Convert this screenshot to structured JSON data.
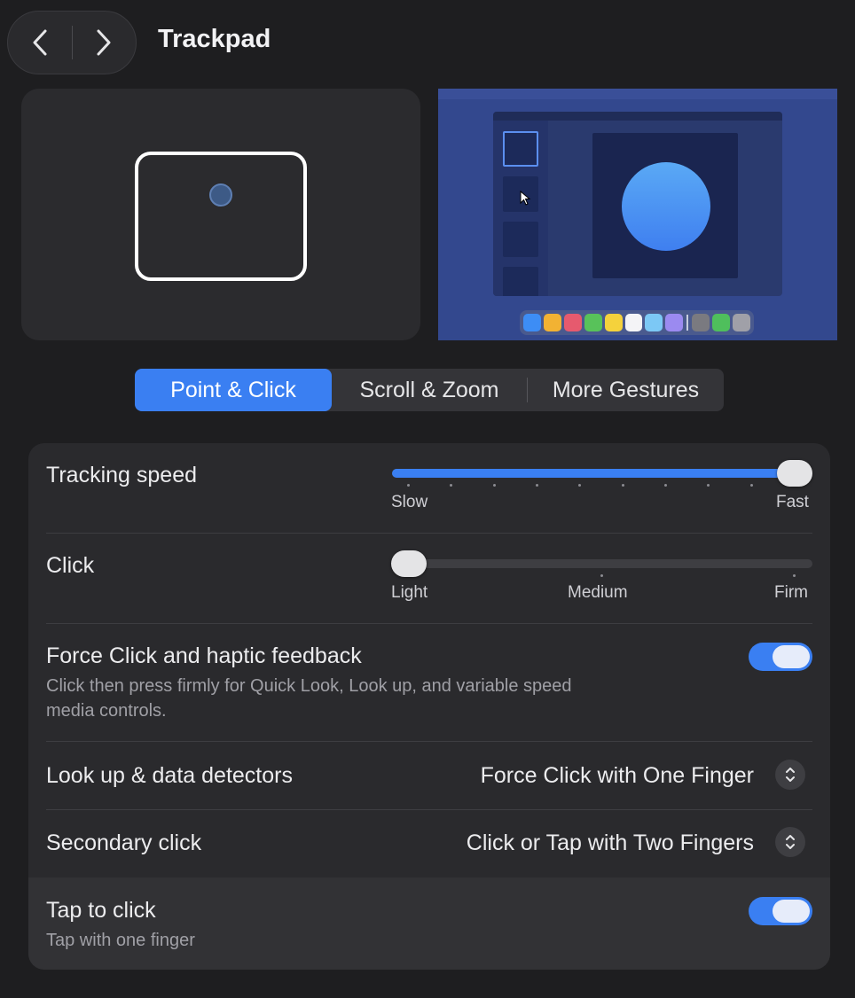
{
  "header": {
    "title": "Trackpad",
    "back_icon": "chevron-left-icon",
    "forward_icon": "chevron-right-icon"
  },
  "tabs": [
    {
      "label": "Point & Click",
      "active": true
    },
    {
      "label": "Scroll & Zoom",
      "active": false
    },
    {
      "label": "More Gestures",
      "active": false
    }
  ],
  "settings": {
    "tracking_speed": {
      "label": "Tracking speed",
      "min_label": "Slow",
      "max_label": "Fast",
      "value": 1.0
    },
    "click": {
      "label": "Click",
      "labels": [
        "Light",
        "Medium",
        "Firm"
      ],
      "value": 0.0
    },
    "force_click": {
      "label": "Force Click and haptic feedback",
      "description_line1": "Click then press firmly for Quick Look, Look up, and variable speed",
      "description_line2": "media controls.",
      "enabled": true
    },
    "look_up": {
      "label": "Look up & data detectors",
      "value": "Force Click with One Finger"
    },
    "secondary_click": {
      "label": "Secondary click",
      "value": "Click or Tap with Two Fingers"
    },
    "tap_to_click": {
      "label": "Tap to click",
      "description": "Tap with one finger",
      "enabled": true
    }
  },
  "colors": {
    "accent": "#3a7ff2",
    "background": "#1e1e20",
    "panel": "#2a2a2d"
  }
}
